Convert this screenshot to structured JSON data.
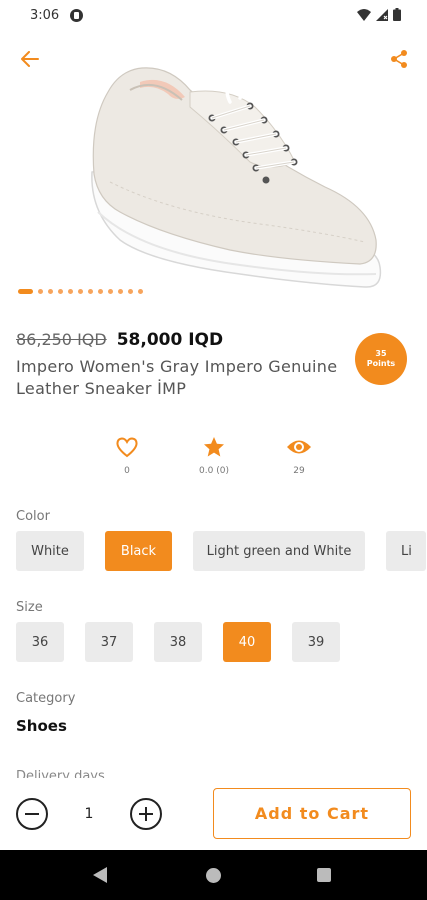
{
  "status_bar": {
    "time": "3:06"
  },
  "product": {
    "old_price": "86,250 IQD",
    "new_price": "58,000 IQD",
    "title": "Impero Women's Gray Impero Genuine Leather Sneaker İMP",
    "points_value": "35",
    "points_label": "Points",
    "image_count": 12,
    "active_image_index": 0
  },
  "stats": {
    "favorites": "0",
    "rating": "0.0 (0)",
    "views": "29"
  },
  "color": {
    "label": "Color",
    "options": [
      "White",
      "Black",
      "Light green and White",
      "Li"
    ],
    "selected": "Black"
  },
  "size": {
    "label": "Size",
    "options": [
      "36",
      "37",
      "38",
      "40",
      "39"
    ],
    "selected": "40"
  },
  "category": {
    "label": "Category",
    "value": "Shoes"
  },
  "delivery": {
    "label": "Delivery days"
  },
  "cart": {
    "quantity": "1",
    "add_label": "Add to Cart"
  },
  "colors": {
    "accent": "#f28b1e",
    "chip_bg": "#ebebeb"
  },
  "icons": {
    "back": "arrow-left-icon",
    "share": "share-icon",
    "favorite": "heart-icon",
    "rating": "star-icon",
    "views": "eye-icon",
    "decrease": "minus-circle-icon",
    "increase": "plus-circle-icon"
  }
}
